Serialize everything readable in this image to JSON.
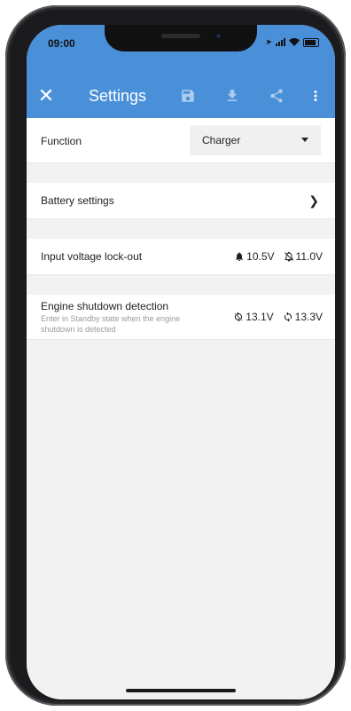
{
  "status": {
    "time": "09:00"
  },
  "appbar": {
    "title": "Settings",
    "icons": [
      "close-icon",
      "save-icon",
      "download-icon",
      "share-icon",
      "more-vert-icon"
    ],
    "color": "#4a90d9"
  },
  "function": {
    "label": "Function",
    "value": "Charger"
  },
  "battery": {
    "label": "Battery settings"
  },
  "input_lockout": {
    "label": "Input voltage lock-out",
    "low": "10.5V",
    "high": "11.0V"
  },
  "engine": {
    "label": "Engine shutdown detection",
    "description": "Enter in Standby state when the engine shutdown is detected",
    "low": "13.1V",
    "high": "13.3V"
  }
}
